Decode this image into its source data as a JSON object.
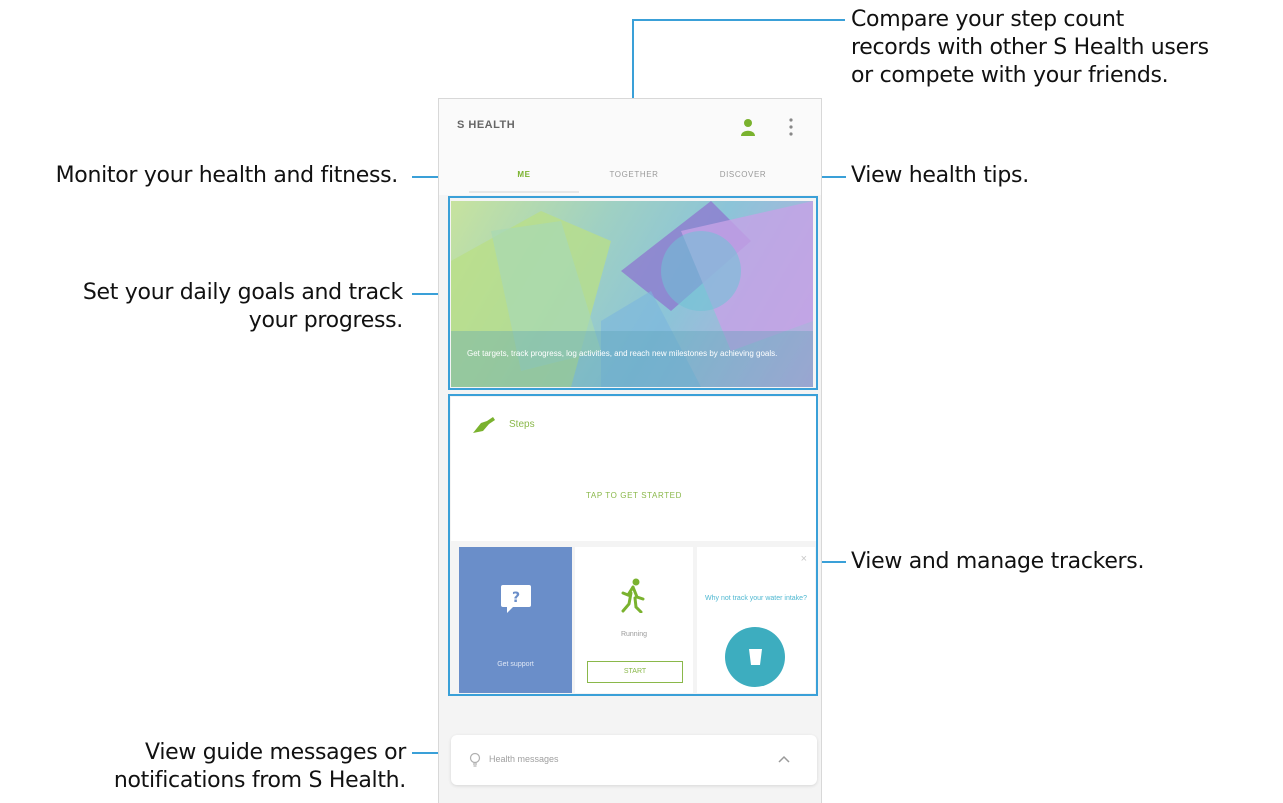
{
  "callouts": {
    "compare": [
      "Compare your step count",
      "records with other S Health users",
      "or compete with your friends."
    ],
    "monitor": "Monitor your health and fitness.",
    "tips": "View health tips.",
    "goals": [
      "Set your daily goals and track",
      "your progress."
    ],
    "trackers": "View and manage trackers.",
    "messages": [
      "View guide messages or",
      "notifications from S Health."
    ]
  },
  "app": {
    "title": "S HEALTH",
    "icons": [
      "profile-icon",
      "more-options-icon"
    ],
    "tabs": [
      {
        "label": "ME",
        "active": true
      },
      {
        "label": "TOGETHER",
        "active": false
      },
      {
        "label": "DISCOVER",
        "active": false
      }
    ]
  },
  "banner": {
    "text": "Get targets, track progress, log activities, and reach new milestones by achieving goals."
  },
  "steps": {
    "label": "Steps",
    "prompt": "TAP TO GET STARTED"
  },
  "trackers": {
    "support": {
      "label": "Get support",
      "icon": "question-bubble-icon"
    },
    "running": {
      "label": "Running",
      "button": "START",
      "icon": "running-person-icon"
    },
    "water": {
      "text": "Why not track your water intake?",
      "icon": "cup-icon",
      "close": "×"
    }
  },
  "messages_bar": {
    "label": "Health messages",
    "icons": [
      "lightbulb-icon",
      "chevron-up-icon"
    ]
  },
  "colors": {
    "accent_green": "#8ab84a",
    "callout_blue": "#3aa0d8",
    "support_blue": "#6a8ec9",
    "water_teal": "#3dadbf"
  }
}
